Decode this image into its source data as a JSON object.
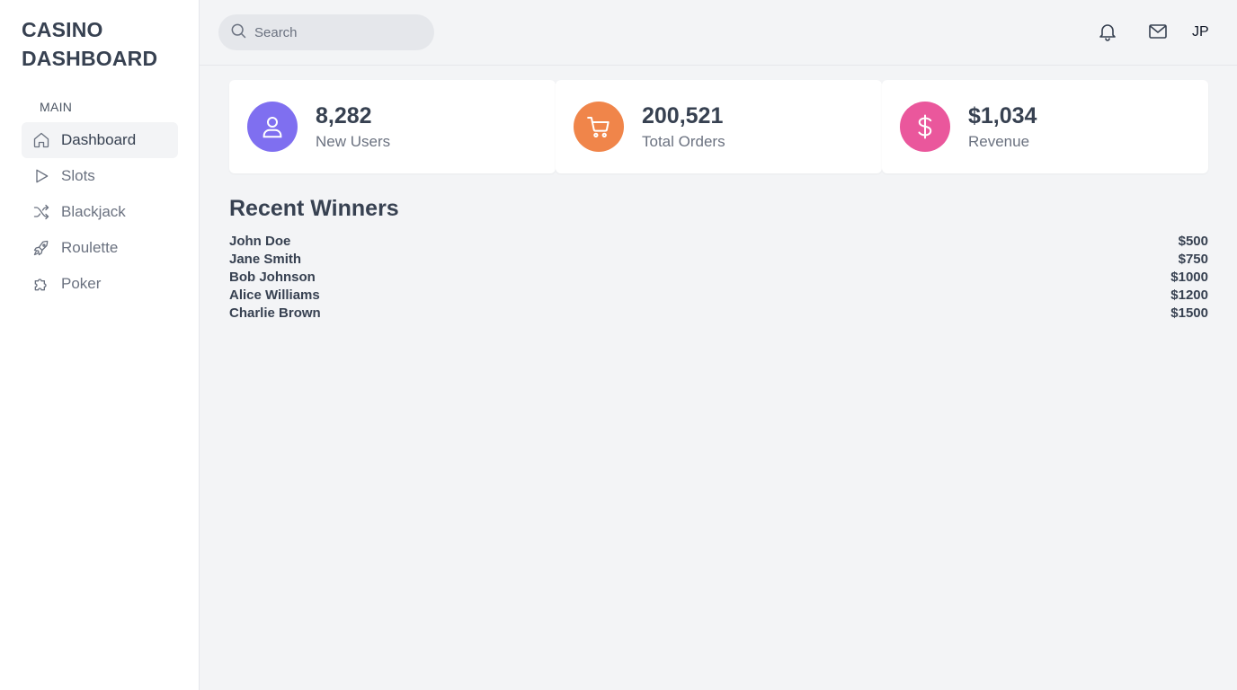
{
  "brand": {
    "title": "CASINO DASHBOARD"
  },
  "sidebar": {
    "section_label": "MAIN",
    "items": [
      {
        "label": "Dashboard",
        "icon": "home-icon",
        "active": true
      },
      {
        "label": "Slots",
        "icon": "play-icon",
        "active": false
      },
      {
        "label": "Blackjack",
        "icon": "shuffle-icon",
        "active": false
      },
      {
        "label": "Roulette",
        "icon": "rocket-icon",
        "active": false
      },
      {
        "label": "Poker",
        "icon": "puzzle-icon",
        "active": false
      }
    ]
  },
  "header": {
    "search_placeholder": "Search",
    "notifications_icon": "bell-icon",
    "messages_icon": "mail-icon",
    "user_initials": "JP"
  },
  "stats": [
    {
      "value": "8,282",
      "label": "New Users",
      "icon": "user-icon",
      "color": "#7f6ff0"
    },
    {
      "value": "200,521",
      "label": "Total Orders",
      "icon": "cart-icon",
      "color": "#f0854a"
    },
    {
      "value": "$1,034",
      "label": "Revenue",
      "icon": "dollar-icon",
      "color": "#ea579c"
    }
  ],
  "winners": {
    "title": "Recent Winners",
    "rows": [
      {
        "name": "John Doe",
        "amount": "$500"
      },
      {
        "name": "Jane Smith",
        "amount": "$750"
      },
      {
        "name": "Bob Johnson",
        "amount": "$1000"
      },
      {
        "name": "Alice Williams",
        "amount": "$1200"
      },
      {
        "name": "Charlie Brown",
        "amount": "$1500"
      }
    ]
  }
}
